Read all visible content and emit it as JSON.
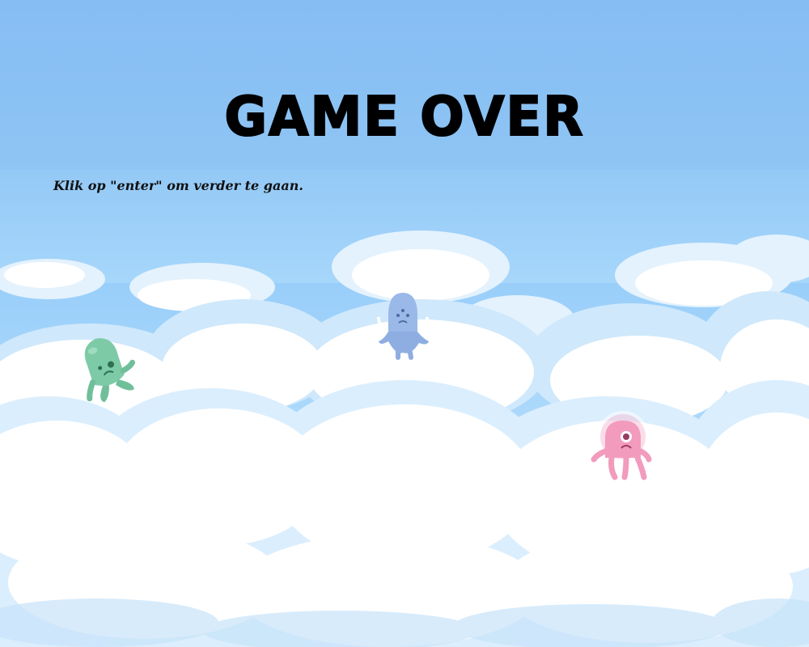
{
  "screen": {
    "title": "GAME OVER",
    "instruction": "Klik op \"enter\" om verder te gaan."
  },
  "characters": [
    {
      "name": "green-alien",
      "color": "#7ccaa6"
    },
    {
      "name": "blue-alien",
      "color": "#9ab8e8"
    },
    {
      "name": "pink-alien",
      "color": "#f29bbd"
    }
  ],
  "colors": {
    "sky": "#86bdf3",
    "cloud_white": "#ffffff",
    "cloud_shade": "#d6ecfc"
  }
}
